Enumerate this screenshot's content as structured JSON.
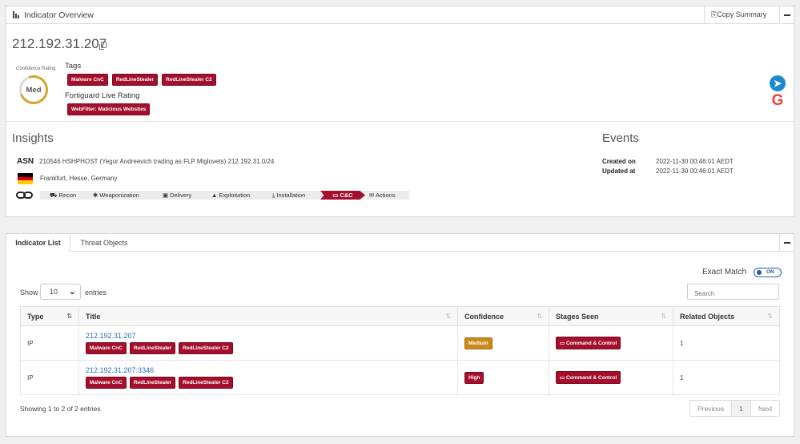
{
  "overview": {
    "header_title": "Indicator Overview",
    "copy_summary_label": "Copy Summary",
    "ip": "212.192.31.207",
    "confidence_label": "Confidence Rating",
    "confidence_value": "Med",
    "tags_label": "Tags",
    "tags": [
      "Malware CnC",
      "RedLineStealer",
      "RedLineStealer C2"
    ],
    "fortiguard_label": "Fortiguard Live Rating",
    "fortiguard_tags": [
      "WebFilter: Malicious Websites"
    ],
    "external_icons": [
      "securitytrails-icon",
      "google-icon"
    ]
  },
  "insights": {
    "title": "Insights",
    "asn_label": "ASN",
    "asn_text": "210546 HSHPHOST (Yegor Andreevich trading as FLP Miglovets) 212.192.31.0/24",
    "location": "Frankfurt, Hesse, Germany",
    "kill_chain": [
      "Recon",
      "Weaponization",
      "Delivery",
      "Exploitation",
      "Installation",
      "C&C",
      "Actions"
    ],
    "kill_chain_active": "C&C"
  },
  "events": {
    "title": "Events",
    "created_label": "Created on",
    "created_value": "2022-11-30 00:46:01 AEDT",
    "updated_label": "Updated at",
    "updated_value": "2022-11-30 00:46:01 AEDT"
  },
  "list_panel": {
    "tabs": [
      "Indicator List",
      "Threat Objects"
    ],
    "exact_match_label": "Exact Match",
    "toggle_label": "ON",
    "show_label": "Show",
    "entries_value": "10",
    "entries_label": "entries",
    "search_placeholder": "Search",
    "columns": [
      "Type",
      "Title",
      "Confidence",
      "Stages Seen",
      "Related Objects"
    ],
    "rows": [
      {
        "type": "IP",
        "title": "212.192.31.207",
        "tags": [
          "Malware CnC",
          "RedLineStealer",
          "RedLineStealer C2"
        ],
        "confidence": "Medium",
        "stage": "Command & Control",
        "related": "1"
      },
      {
        "type": "IP",
        "title": "212.192.31.207:3346",
        "tags": [
          "Malware CnC",
          "RedLineStealer",
          "RedLineStealer C2"
        ],
        "confidence": "High",
        "stage": "Command & Control",
        "related": "1"
      }
    ],
    "showing_text": "Showing 1 to 2 of 2 entries",
    "pager_prev": "Previous",
    "pager_current": "1",
    "pager_next": "Next"
  },
  "colors": {
    "tag_red": "#a30f2c",
    "medium_amber": "#c98a1b",
    "link_blue": "#2a6db4",
    "gauge_amber": "#d6a32e"
  }
}
